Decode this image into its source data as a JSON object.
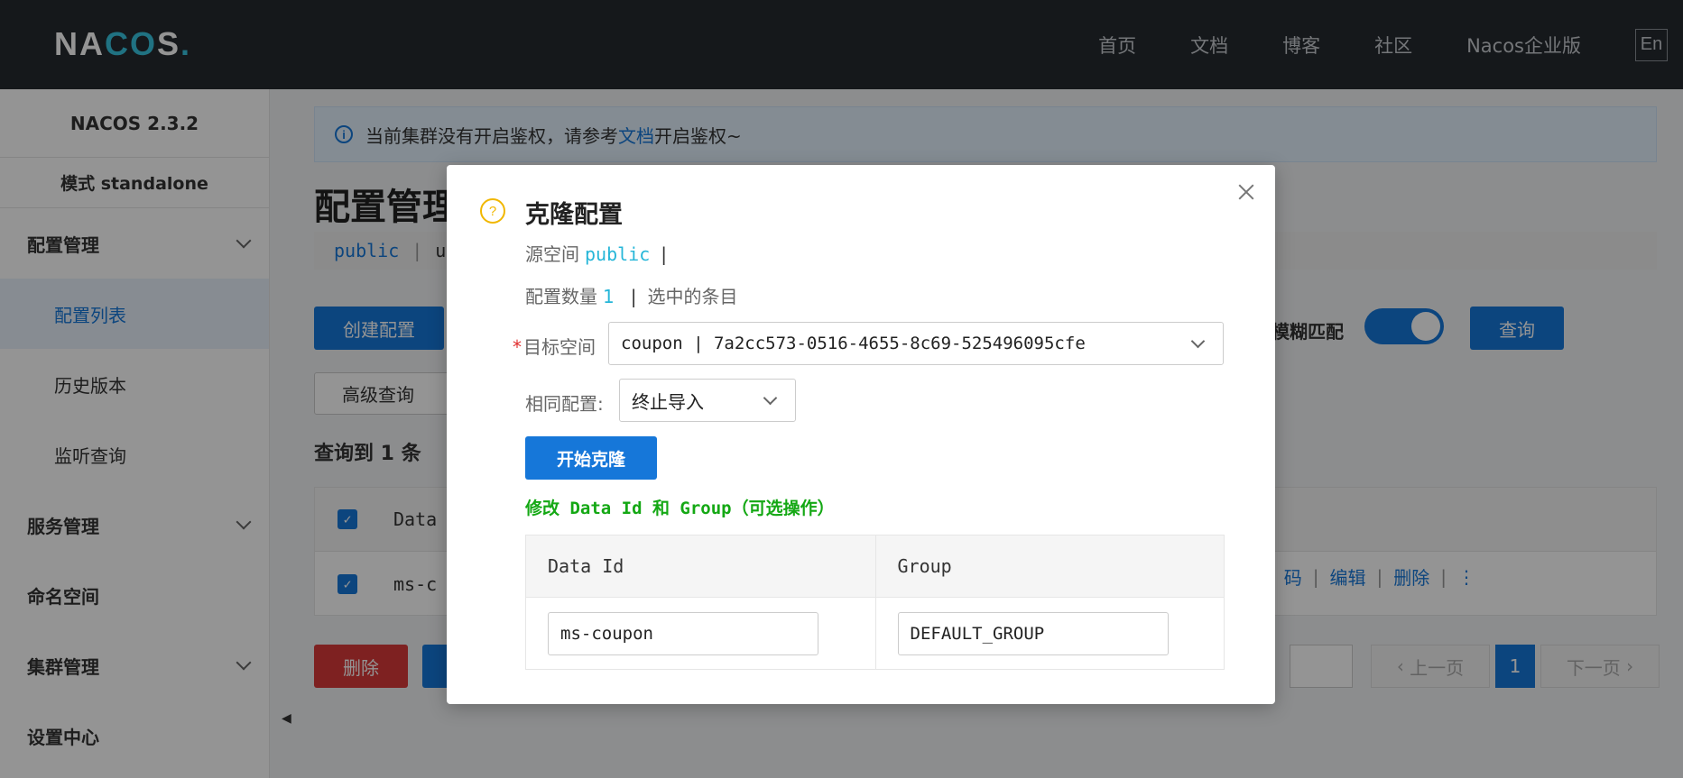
{
  "header": {
    "logo": "NACOS.",
    "nav": [
      "首页",
      "文档",
      "博客",
      "社区",
      "Nacos企业版"
    ],
    "lang": "En"
  },
  "sidebar": {
    "version": "NACOS 2.3.2",
    "mode": "模式 standalone",
    "items": [
      {
        "label": "配置管理",
        "expandable": true
      },
      {
        "label": "配置列表",
        "active": true,
        "sub": true
      },
      {
        "label": "历史版本",
        "sub": true
      },
      {
        "label": "监听查询",
        "sub": true
      },
      {
        "label": "服务管理",
        "expandable": true
      },
      {
        "label": "命名空间"
      },
      {
        "label": "集群管理",
        "expandable": true
      },
      {
        "label": "设置中心"
      }
    ]
  },
  "main": {
    "notice_prefix": "当前集群没有开启鉴权，请参考",
    "notice_link": "文档",
    "notice_suffix": "开启鉴权~",
    "title": "配置管理",
    "ns_public": "public",
    "ns_sep": "|",
    "ns_next": "u",
    "create_btn": "创建配置",
    "advanced_btn": "高级查询",
    "fuzzy_label": "模糊匹配",
    "query_btn": "查询",
    "result_text": "查询到 1 条",
    "table_header": "Data",
    "row_dataid": "ms-c",
    "row_ops": [
      "码",
      "编辑",
      "删除"
    ],
    "delete_btn": "删除",
    "prev_page": "上一页",
    "page_num": "1",
    "next_page": "下一页"
  },
  "dialog": {
    "title": "克隆配置",
    "source_label": "源空间",
    "source_ns": "public",
    "pipe": "|",
    "count_label": "配置数量",
    "count": "1",
    "selected_text": "选中的条目",
    "target_label": "目标空间",
    "target_value": "coupon | 7a2cc573-0516-4655-8c69-525496095cfe",
    "same_label": "相同配置:",
    "same_value": "终止导入",
    "clone_btn": "开始克隆",
    "modify_text": "修改 Data Id 和 Group（可选操作）",
    "col_dataid": "Data Id",
    "col_group": "Group",
    "dataid_value": "ms-coupon",
    "group_value": "DEFAULT_GROUP"
  },
  "colors": {
    "primary": "#1677d9",
    "danger": "#d9393a",
    "header_bg": "#252a2f",
    "highlight": "#26b6d8",
    "success_text": "#14a814",
    "warning": "#f1b700"
  }
}
